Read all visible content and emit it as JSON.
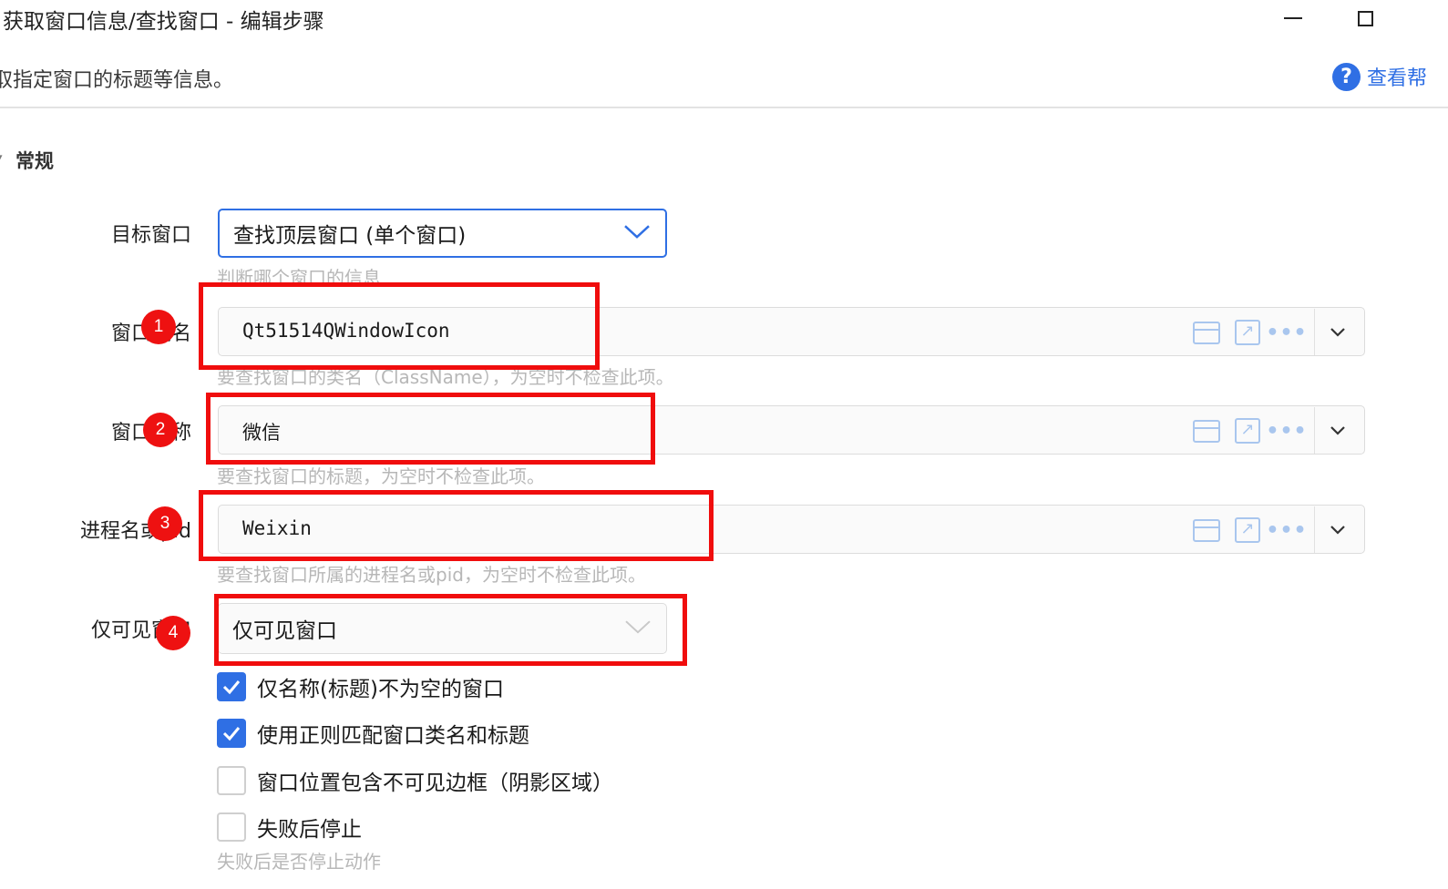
{
  "window": {
    "title": "获取窗口信息/查找窗口  -  编辑步骤",
    "description": "取指定窗口的标题等信息。",
    "help_label": "查看帮",
    "help_icon": "?"
  },
  "section": {
    "title": "常规",
    "caret": "▾"
  },
  "fields": {
    "target": {
      "label": "目标窗口",
      "value": "查找顶层窗口 (单个窗口)",
      "hint": "判断哪个窗口的信息"
    },
    "class_name": {
      "label": "窗口类名",
      "value": "Qt51514QWindowIcon",
      "hint": "要查找窗口的类名（ClassName），为空时不检查此项。"
    },
    "window_name": {
      "label": "窗口名称",
      "value": "微信",
      "hint": "要查找窗口的标题，为空时不检查此项。"
    },
    "process": {
      "label": "进程名或pid",
      "value": "Weixin",
      "hint": "要查找窗口所属的进程名或pid，为空时不检查此项。"
    },
    "visible_only": {
      "label": "仅可见窗口",
      "value": "仅可见窗口"
    }
  },
  "checkboxes": [
    {
      "label": "仅名称(标题)不为空的窗口",
      "checked": true
    },
    {
      "label": "使用正则匹配窗口类名和标题",
      "checked": true
    },
    {
      "label": "窗口位置包含不可见边框（阴影区域）",
      "checked": false
    },
    {
      "label": "失败后停止",
      "checked": false
    }
  ],
  "stop_hint": "失败后是否停止动作",
  "annotations": [
    "1",
    "2",
    "3",
    "4"
  ],
  "colors": {
    "accent": "#2f6fe4",
    "annotation_red": "#f00d0d",
    "icon_light_blue": "#a9c6ee"
  },
  "icons": {
    "field_actions": [
      "window-picker-icon",
      "open-external-icon",
      "more-icon",
      "chevron-down-icon"
    ],
    "checkbox_check": "checkmark-icon"
  }
}
